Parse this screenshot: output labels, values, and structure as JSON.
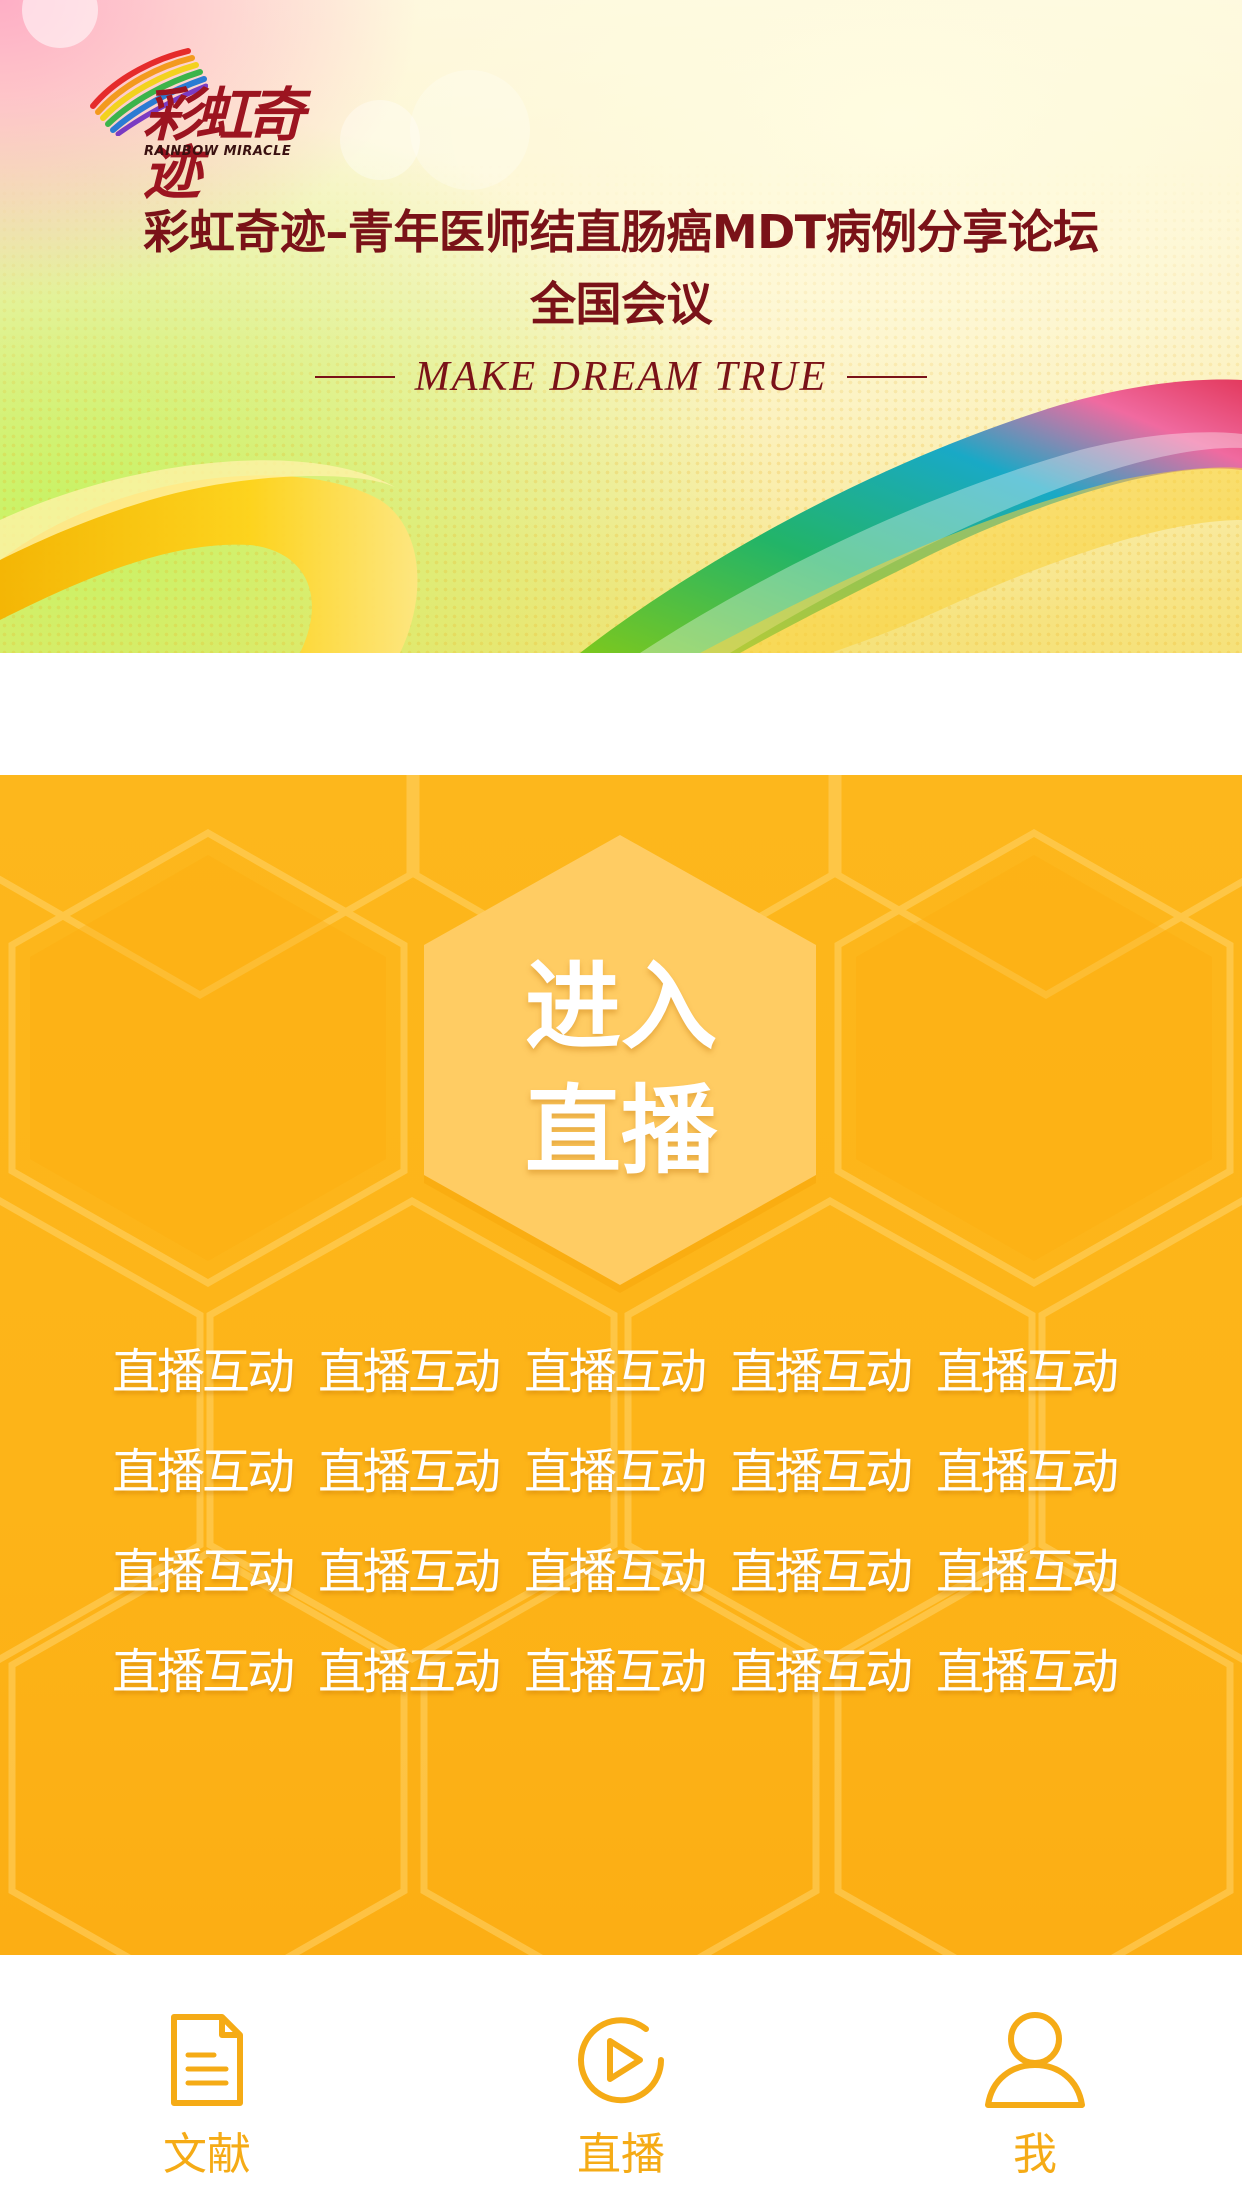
{
  "banner": {
    "logo_mark": "彩虹奇迹",
    "logo_sub": "RAINBOW MIRACLE",
    "title_line1": "彩虹奇迹–青年医师结直肠癌MDT病例分享论坛",
    "title_line2": "全国会议",
    "tagline": "MAKE DREAM TRUE"
  },
  "live": {
    "enter_line1": "进入",
    "enter_line2": "直播",
    "chip_label": "直播互动",
    "chip_rows": 4,
    "chip_cols": 5
  },
  "tabs": [
    {
      "label": "文献",
      "icon": "document-icon"
    },
    {
      "label": "直播",
      "icon": "play-circle-icon"
    },
    {
      "label": "我",
      "icon": "user-icon"
    }
  ],
  "colors": {
    "accent": "#f5ab16",
    "title": "#7a1218",
    "panel": "#fdb71c"
  }
}
